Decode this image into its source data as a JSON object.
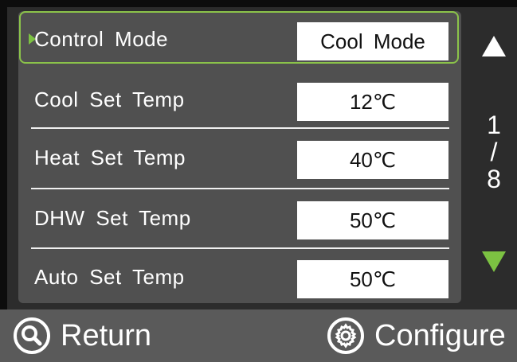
{
  "settings_rows": [
    {
      "label": "Control Mode",
      "value": "Cool Mode",
      "selected": true
    },
    {
      "label": "Cool Set Temp",
      "value": "12℃",
      "selected": false
    },
    {
      "label": "Heat Set Temp",
      "value": "40℃",
      "selected": false
    },
    {
      "label": "DHW Set Temp",
      "value": "50℃",
      "selected": false
    },
    {
      "label": "Auto Set Temp",
      "value": "50℃",
      "selected": false
    }
  ],
  "pager": {
    "current": "1",
    "separator": "/",
    "total": "8"
  },
  "footer": {
    "return_label": "Return",
    "configure_label": "Configure"
  },
  "icons": {
    "up": "arrow-up-icon",
    "down": "arrow-down-icon",
    "return": "search-icon",
    "configure": "gear-icon"
  },
  "colors": {
    "accent": "#7cc242",
    "panel": "#505050",
    "background": "#0d0d0d",
    "footer": "#5a5a5a"
  }
}
